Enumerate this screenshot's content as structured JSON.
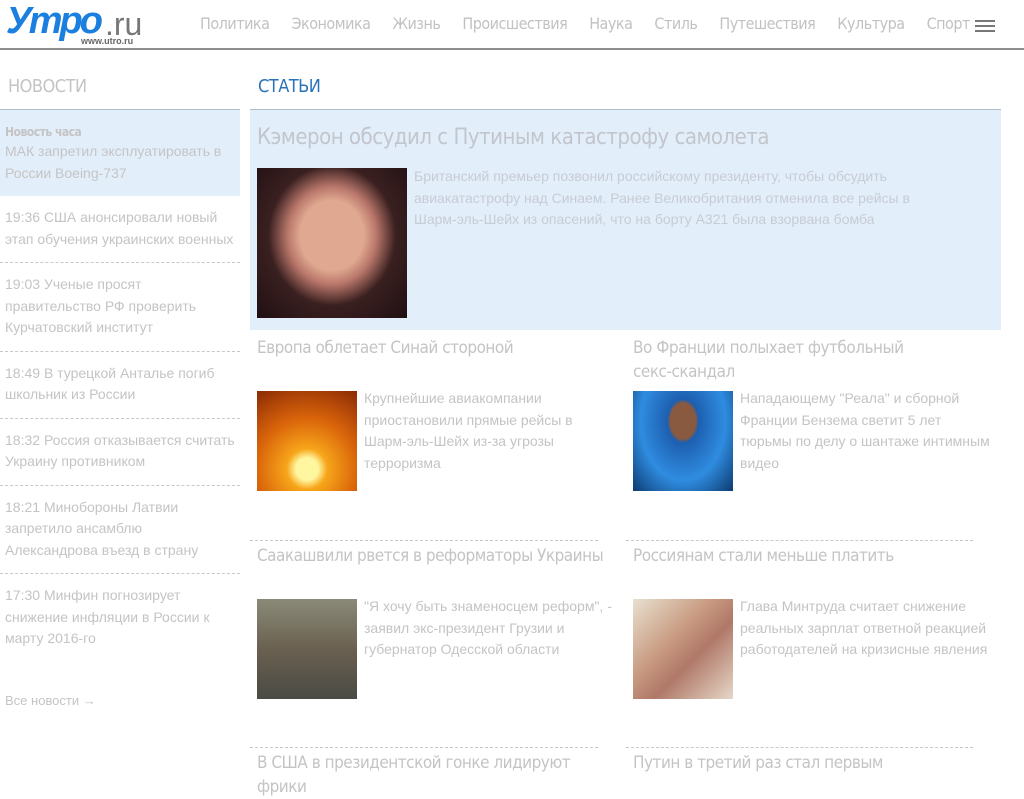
{
  "header": {
    "logo": "Утро",
    "logo_tld": ".ru",
    "logo_url": "www.utro.ru",
    "nav": [
      "Политика",
      "Экономика",
      "Жизнь",
      "Происшествия",
      "Наука",
      "Стиль",
      "Путешествия",
      "Культура",
      "Спорт"
    ],
    "menu_icon": "hamburger-icon"
  },
  "news": {
    "title": "НОВОСТИ",
    "hot_label": "Новость часа",
    "hot_text": "МАК запретил эксплуатировать в России Boeing-737",
    "items": [
      {
        "time": "19:36",
        "text": "США анонсировали новый этап обучения украинских военных"
      },
      {
        "time": "19:03",
        "text": "Ученые просят правительство РФ проверить Курчатовский институт"
      },
      {
        "time": "18:49",
        "text": "В турецкой Анталье погиб школьник из России"
      },
      {
        "time": "18:32",
        "text": "Россия отказывается считать Украину противником"
      },
      {
        "time": "18:21",
        "text": "Минобороны Латвии запретило ансамблю Александрова въезд в страну"
      },
      {
        "time": "17:30",
        "text": "Минфин погнозирует снижение инфляции в России к марту 2016-го"
      }
    ],
    "all": "Все новости →"
  },
  "articles": {
    "title": "СТАТЬИ",
    "lead": {
      "title": "Кэмерон обсудил с Путиным катастрофу самолета",
      "text": "Британский премьер позвонил российскому президенту, чтобы обсудить авиакатастрофу над Синаем. Ранее Великобритания отменила все рейсы в Шарм-эль-Шейх из опасений, что на борту А321 была взорвана бомба"
    },
    "cards": [
      {
        "title": "Европа облетает Синай стороной",
        "text": "Крупнейшие авиакомпании приостановили прямые рейсы в Шарм-эль-Шейх из-за угрозы терроризма"
      },
      {
        "title": "Во Франции полыхает футбольный секс-скандал",
        "text": "Нападающему \"Реала\" и сборной Франции Бензема светит 5 лет тюрьмы по делу о шантаже интимным видео"
      },
      {
        "title": "Саакашвили рвется в реформаторы Украины",
        "text": "\"Я хочу быть знаменосцем реформ\", - заявил экс-президент Грузии и губернатор Одесской области"
      },
      {
        "title": "Россиянам стали меньше платить",
        "text": "Глава Минтруда считает снижение реальных зарплат ответной реакцией работодателей на кризисные явления"
      },
      {
        "title": "В США в президентской гонке лидируют фрики"
      },
      {
        "title": "Путин в третий раз стал первым"
      }
    ]
  },
  "colors": {
    "accent": "#2a73b8",
    "highlight_bg": "#e3eefb",
    "logo": "#1b7fe0"
  }
}
